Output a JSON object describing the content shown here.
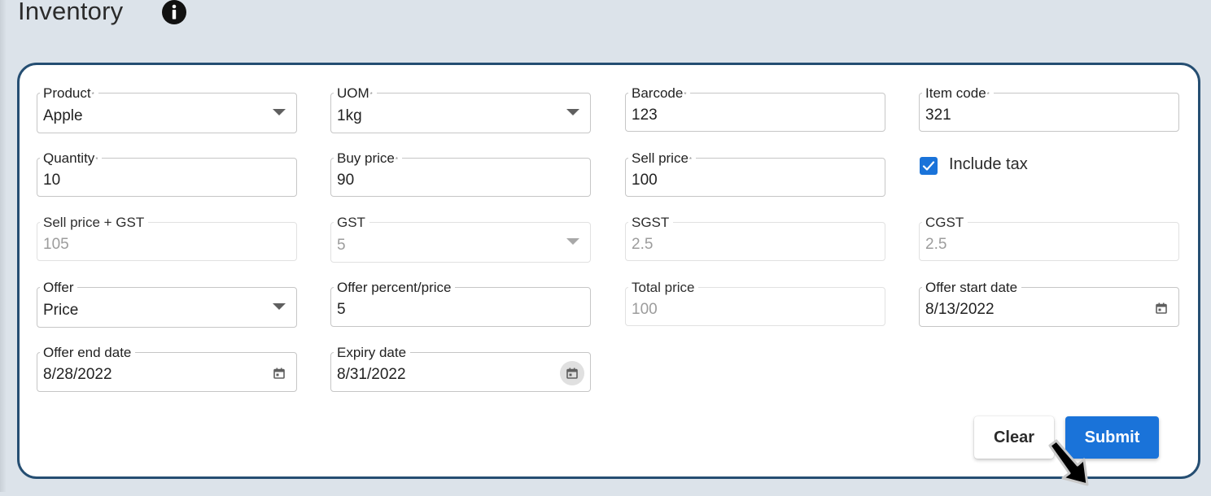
{
  "page": {
    "title": "Inventory"
  },
  "form": {
    "product": {
      "label": "Product",
      "required": "*",
      "value": "Apple"
    },
    "uom": {
      "label": "UOM",
      "required": "*",
      "value": "1kg"
    },
    "barcode": {
      "label": "Barcode",
      "required": "*",
      "value": "123"
    },
    "item_code": {
      "label": "Item code",
      "required": "*",
      "value": "321"
    },
    "quantity": {
      "label": "Quantity",
      "required": "*",
      "value": "10"
    },
    "buy_price": {
      "label": "Buy price",
      "required": "*",
      "value": "90"
    },
    "sell_price": {
      "label": "Sell price",
      "required": "*",
      "value": "100"
    },
    "include_tax": {
      "label": "Include tax",
      "checked": true
    },
    "sell_price_gst": {
      "label": "Sell price + GST",
      "value": "105"
    },
    "gst": {
      "label": "GST",
      "value": "5"
    },
    "sgst": {
      "label": "SGST",
      "value": "2.5"
    },
    "cgst": {
      "label": "CGST",
      "value": "2.5"
    },
    "offer": {
      "label": "Offer",
      "value": "Price"
    },
    "offer_value": {
      "label": "Offer percent/price",
      "value": "5"
    },
    "total_price": {
      "label": "Total price",
      "value": "100"
    },
    "offer_start_date": {
      "label": "Offer start date",
      "value": "8/13/2022"
    },
    "offer_end_date": {
      "label": "Offer end date",
      "value": "8/28/2022"
    },
    "expiry_date": {
      "label": "Expiry date",
      "value": "8/31/2022"
    }
  },
  "actions": {
    "clear_label": "Clear",
    "submit_label": "Submit"
  },
  "icons": {
    "info": "info-icon",
    "dropdown": "chevron-down-icon",
    "calendar": "calendar-icon",
    "checkmark": "checkmark-icon",
    "cursor": "arrow-cursor-icon"
  },
  "colors": {
    "background": "#dce3ea",
    "card_border": "#254e72",
    "primary": "#1a73d9",
    "disabled_text": "#9c9c9c"
  }
}
